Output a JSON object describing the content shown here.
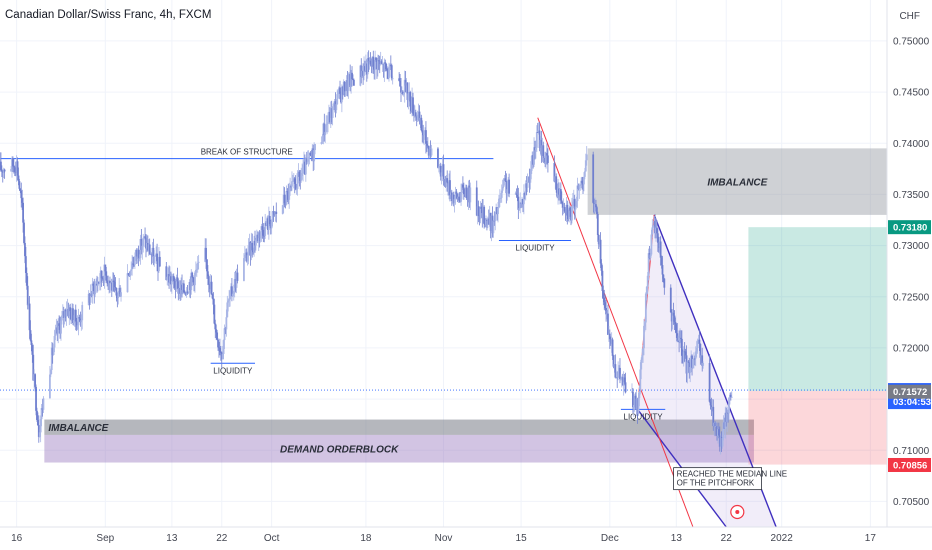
{
  "header": {
    "symbol": "Canadian Dollar/Swiss Franc, 4h, FXCM",
    "currency": "CHF"
  },
  "chart_data": {
    "type": "candlestick",
    "ylim": [
      0.7025,
      0.754
    ],
    "y_ticks": [
      0.75,
      0.745,
      0.74,
      0.735,
      0.73,
      0.725,
      0.72,
      0.715,
      0.71,
      0.705
    ],
    "y_tick_labels": [
      "0.75000",
      "0.74500",
      "0.74000",
      "0.73500",
      "0.73000",
      "0.72500",
      "0.72000",
      "0.71500",
      "0.71000",
      "0.70500"
    ],
    "x_range": [
      "2021-08-13",
      "2022-01-20"
    ],
    "x_ticks": [
      {
        "date": "2021-08-16",
        "label": "16"
      },
      {
        "date": "2021-09-01",
        "label": "Sep"
      },
      {
        "date": "2021-09-13",
        "label": "13"
      },
      {
        "date": "2021-09-22",
        "label": "22"
      },
      {
        "date": "2021-10-01",
        "label": "Oct"
      },
      {
        "date": "2021-10-18",
        "label": "18"
      },
      {
        "date": "2021-11-01",
        "label": "Nov"
      },
      {
        "date": "2021-11-15",
        "label": "15"
      },
      {
        "date": "2021-12-01",
        "label": "Dec"
      },
      {
        "date": "2021-12-13",
        "label": "13"
      },
      {
        "date": "2021-12-22",
        "label": "22"
      },
      {
        "date": "2022-01-01",
        "label": "2022"
      },
      {
        "date": "2022-01-17",
        "label": "17"
      }
    ],
    "price_path": [
      [
        "2021-08-13",
        0.7375
      ],
      [
        "2021-08-16",
        0.738
      ],
      [
        "2021-08-17",
        0.7335
      ],
      [
        "2021-08-18",
        0.725
      ],
      [
        "2021-08-19",
        0.7175
      ],
      [
        "2021-08-20",
        0.712
      ],
      [
        "2021-08-21",
        0.7155
      ],
      [
        "2021-08-23",
        0.721
      ],
      [
        "2021-08-25",
        0.724
      ],
      [
        "2021-08-27",
        0.7225
      ],
      [
        "2021-08-30",
        0.726
      ],
      [
        "2021-09-01",
        0.7275
      ],
      [
        "2021-09-03",
        0.725
      ],
      [
        "2021-09-06",
        0.7285
      ],
      [
        "2021-09-08",
        0.7305
      ],
      [
        "2021-09-10",
        0.7285
      ],
      [
        "2021-09-13",
        0.7265
      ],
      [
        "2021-09-15",
        0.7255
      ],
      [
        "2021-09-17",
        0.727
      ],
      [
        "2021-09-19",
        0.729
      ],
      [
        "2021-09-20",
        0.726
      ],
      [
        "2021-09-21",
        0.7215
      ],
      [
        "2021-09-22",
        0.7195
      ],
      [
        "2021-09-23",
        0.724
      ],
      [
        "2021-09-25",
        0.7275
      ],
      [
        "2021-09-27",
        0.7295
      ],
      [
        "2021-09-29",
        0.7315
      ],
      [
        "2021-10-01",
        0.7325
      ],
      [
        "2021-10-04",
        0.735
      ],
      [
        "2021-10-06",
        0.7365
      ],
      [
        "2021-10-08",
        0.7385
      ],
      [
        "2021-10-11",
        0.742
      ],
      [
        "2021-10-13",
        0.7445
      ],
      [
        "2021-10-15",
        0.746
      ],
      [
        "2021-10-18",
        0.7475
      ],
      [
        "2021-10-20",
        0.748
      ],
      [
        "2021-10-22",
        0.747
      ],
      [
        "2021-10-25",
        0.7455
      ],
      [
        "2021-10-27",
        0.743
      ],
      [
        "2021-10-29",
        0.74
      ],
      [
        "2021-11-01",
        0.737
      ],
      [
        "2021-11-03",
        0.7345
      ],
      [
        "2021-11-05",
        0.7355
      ],
      [
        "2021-11-08",
        0.733
      ],
      [
        "2021-11-10",
        0.732
      ],
      [
        "2021-11-12",
        0.736
      ],
      [
        "2021-11-15",
        0.734
      ],
      [
        "2021-11-17",
        0.738
      ],
      [
        "2021-11-18",
        0.741
      ],
      [
        "2021-11-19",
        0.739
      ],
      [
        "2021-11-22",
        0.735
      ],
      [
        "2021-11-24",
        0.733
      ],
      [
        "2021-11-26",
        0.7365
      ],
      [
        "2021-11-27",
        0.7385
      ],
      [
        "2021-11-29",
        0.731
      ],
      [
        "2021-11-30",
        0.724
      ],
      [
        "2021-12-02",
        0.718
      ],
      [
        "2021-12-04",
        0.716
      ],
      [
        "2021-12-06",
        0.714
      ],
      [
        "2021-12-07",
        0.72
      ],
      [
        "2021-12-08",
        0.729
      ],
      [
        "2021-12-09",
        0.732
      ],
      [
        "2021-12-10",
        0.73
      ],
      [
        "2021-12-11",
        0.725
      ],
      [
        "2021-12-13",
        0.7215
      ],
      [
        "2021-12-15",
        0.718
      ],
      [
        "2021-12-17",
        0.72
      ],
      [
        "2021-12-19",
        0.715
      ],
      [
        "2021-12-20",
        0.712
      ],
      [
        "2021-12-21",
        0.7105
      ],
      [
        "2021-12-22",
        0.7135
      ],
      [
        "2021-12-23",
        0.7158
      ]
    ],
    "horizontal_lines": [
      {
        "label": "BREAK OF STRUCTURE",
        "price": 0.7385,
        "from": "2021-08-13",
        "to": "2021-11-10",
        "color": "#2962ff"
      },
      {
        "label": "LIQUIDITY",
        "price": 0.7305,
        "from": "2021-11-11",
        "to": "2021-11-24",
        "color": "#2962ff"
      },
      {
        "label": "LIQUIDITY",
        "price": 0.7185,
        "from": "2021-09-20",
        "to": "2021-09-28",
        "color": "#2962ff"
      },
      {
        "label": "LIQUIDITY",
        "price": 0.714,
        "from": "2021-12-03",
        "to": "2021-12-11",
        "color": "#2962ff"
      }
    ],
    "zones": [
      {
        "label": "IMBALANCE",
        "from": "2021-11-27",
        "to": "2022-01-20",
        "top": 0.7395,
        "bottom": 0.733,
        "color": "#9598a1"
      },
      {
        "label": "IMBALANCE",
        "from": "2021-08-21",
        "to": "2021-12-27",
        "top": 0.713,
        "bottom": 0.7115,
        "color": "#787b86"
      },
      {
        "label": "DEMAND ORDERBLOCK",
        "from": "2021-08-21",
        "to": "2021-12-27",
        "top": 0.7115,
        "bottom": 0.7088,
        "color": "#9c7cc0"
      }
    ],
    "fib_lines": [
      {
        "points": [
          [
            "2021-11-18",
            0.7425
          ],
          [
            "2021-12-16",
            0.7025
          ]
        ],
        "color": "#f23645"
      },
      {
        "points": [
          [
            "2021-12-06",
            0.714
          ],
          [
            "2021-12-09",
            0.733
          ]
        ],
        "color": "#f23645"
      }
    ],
    "pitchfork": {
      "upper": [
        [
          "2021-12-09",
          0.733
        ],
        [
          "2021-12-31",
          0.7025
        ]
      ],
      "lower": [
        [
          "2021-12-06",
          0.714
        ],
        [
          "2021-12-22",
          0.7025
        ]
      ],
      "color": "#3f2fbf"
    },
    "position": {
      "entry": 0.7158,
      "target": 0.7318,
      "stop": 0.7086,
      "from": "2021-12-26",
      "to": "2022-01-20"
    },
    "annotation": {
      "text_line1": "REACHED THE MEDIAN LINE",
      "text_line2": "OF THE PITCHFORK"
    },
    "price_tags": [
      {
        "label": "0.73180",
        "price": 0.7318,
        "color": "#089981"
      },
      {
        "label": "0.71588",
        "price": 0.71588,
        "color": "#2962ff",
        "sub": "03:04:53"
      },
      {
        "label": "0.71572",
        "price": 0.71572,
        "color": "#787b86"
      },
      {
        "label": "0.70856",
        "price": 0.70856,
        "color": "#f23645"
      }
    ]
  }
}
